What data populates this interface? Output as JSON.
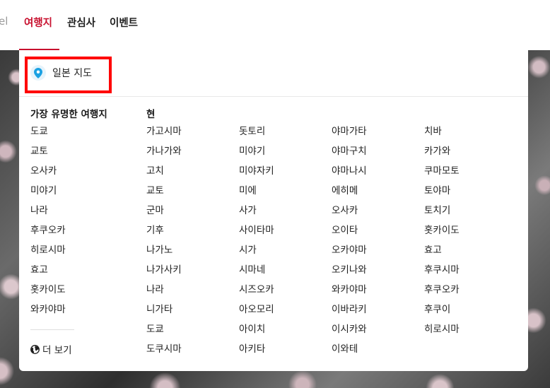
{
  "nav": {
    "cut_label": "el",
    "tabs": [
      {
        "label": "여행지",
        "active": true
      },
      {
        "label": "관심사",
        "active": false
      },
      {
        "label": "이벤트",
        "active": false
      }
    ]
  },
  "colors": {
    "accent": "#c8102e",
    "highlight": "#ff0000",
    "map_icon": "#1ba1e2"
  },
  "panel": {
    "map_link": {
      "icon": "map-pin-icon",
      "label": "일본 지도"
    },
    "famous": {
      "heading": "가장 유명한 여행지",
      "items": [
        "도쿄",
        "교토",
        "오사카",
        "미야기",
        "나라",
        "후쿠오카",
        "히로시마",
        "효고",
        "홋카이도",
        "와카야마"
      ],
      "more": {
        "icon": "globe-icon",
        "label": "더 보기"
      }
    },
    "prefectures": {
      "heading": "현",
      "columns": [
        [
          "가고시마",
          "가나가와",
          "고치",
          "교토",
          "군마",
          "기후",
          "나가노",
          "나가사키",
          "나라",
          "니가타",
          "도쿄",
          "도쿠시마"
        ],
        [
          "돗토리",
          "미야기",
          "미야자키",
          "미에",
          "사가",
          "사이타마",
          "시가",
          "시마네",
          "시즈오카",
          "아오모리",
          "아이치",
          "아키타"
        ],
        [
          "야마가타",
          "야마구치",
          "야마나시",
          "에히메",
          "오사카",
          "오이타",
          "오카야마",
          "오키나와",
          "와카야마",
          "이바라키",
          "이시카와",
          "이와테"
        ],
        [
          "치바",
          "카가와",
          "쿠마모토",
          "토야마",
          "토치기",
          "홋카이도",
          "효고",
          "후쿠시마",
          "후쿠오카",
          "후쿠이",
          "히로시마"
        ]
      ]
    }
  }
}
